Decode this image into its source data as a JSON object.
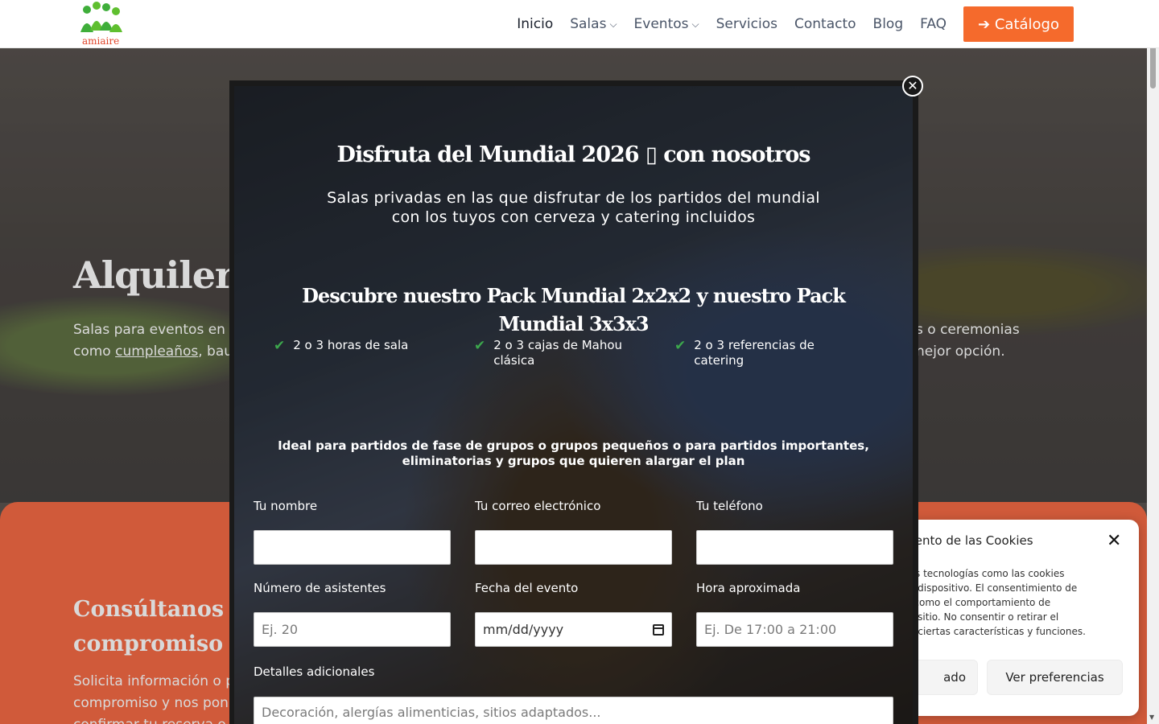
{
  "header": {
    "logo_alt": "amiaire",
    "nav": [
      {
        "label": "Inicio",
        "has_dropdown": false
      },
      {
        "label": "Salas",
        "has_dropdown": true
      },
      {
        "label": "Eventos",
        "has_dropdown": true
      },
      {
        "label": "Servicios",
        "has_dropdown": false
      },
      {
        "label": "Contacto",
        "has_dropdown": false
      },
      {
        "label": "Blog",
        "has_dropdown": false
      },
      {
        "label": "FAQ",
        "has_dropdown": false
      }
    ],
    "catalog_button": "➔ Catálogo"
  },
  "hero": {
    "title": "Alquiler",
    "text_left_line1": "Salas para eventos en",
    "text_left_line2_prefix": "como ",
    "text_left_link": "cumpleaños",
    "text_left_line2_suffix": ", bau",
    "text_right_line1": "s o ceremonias",
    "text_right_line2": "nejor opción."
  },
  "section": {
    "title_line1": "Consúltanos o p",
    "title_line2": "compromiso",
    "text_line1": "Solicita información o p",
    "text_line2": "compromiso y nos pon",
    "text_line3": "confirmar tu reserva o"
  },
  "modal": {
    "title": "Disfruta del Mundial 2026 ▯ con nosotros",
    "subtitle_line1": "Salas privadas en las que disfrutar de los partidos del mundial",
    "subtitle_line2": "con los tuyos con cerveza y catering incluidos",
    "pack_title": "Descubre nuestro Pack Mundial 2x2x2 y nuestro Pack Mundial 3x3x3",
    "features": [
      {
        "line1": "2 o 3 horas de sala",
        "line2": ""
      },
      {
        "line1": "2 o 3 cajas de Mahou",
        "line2": "clásica"
      },
      {
        "line1": "2 o 3 referencias de",
        "line2": "catering"
      }
    ],
    "ideal_line1": "Ideal para partidos de fase de grupos o grupos pequeños o para partidos importantes,",
    "ideal_line2": "eliminatorias y grupos que quieren alargar el plan",
    "form": {
      "name_label": "Tu nombre",
      "email_label": "Tu correo electrónico",
      "phone_label": "Tu teléfono",
      "attendees_label": "Número de asistentes",
      "attendees_placeholder": "Ej. 20",
      "date_label": "Fecha del evento",
      "date_placeholder": "mm/dd/yyyy",
      "time_label": "Hora aproximada",
      "time_placeholder": "Ej. De 17:00 a 21:00",
      "details_label": "Detalles adicionales",
      "details_placeholder": "Decoración, alergías alimenticias, sitios adaptados..."
    }
  },
  "cookie_banner": {
    "title": "miento de las Cookies",
    "text_lines": [
      "mos tecnologías como las cookies",
      "del dispositivo. El consentimiento de",
      "os como el comportamiento de",
      "ste sitio. No consentir o retirar el",
      "e a ciertas características y funciones."
    ],
    "button_partial": "ado",
    "button_preferences": "Ver preferencias"
  },
  "colors": {
    "accent_orange": "#f56a2c",
    "section_orange": "#f56a45",
    "check_green": "#3ca64c"
  }
}
